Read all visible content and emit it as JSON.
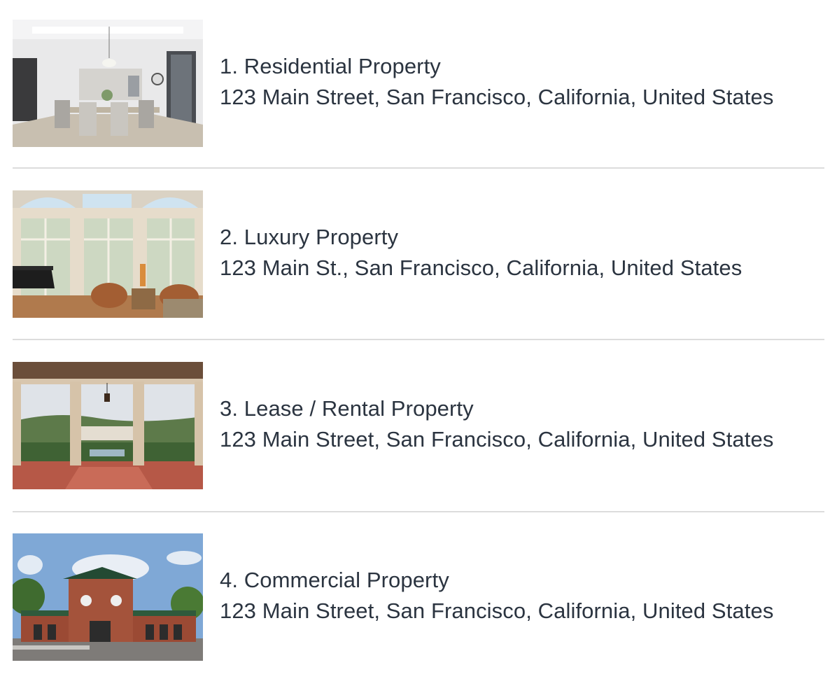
{
  "listings": [
    {
      "title": "1. Residential Property",
      "address": "123 Main Street, San Francisco, California, United States",
      "thumbnail": "dining-room-photo"
    },
    {
      "title": "2. Luxury Property",
      "address": "123 Main St., San Francisco, California, United States",
      "thumbnail": "living-room-photo"
    },
    {
      "title": "3. Lease / Rental Property",
      "address": "123 Main Street, San Francisco, California, United States",
      "thumbnail": "courtyard-photo"
    },
    {
      "title": "4. Commercial Property",
      "address": "123 Main Street, San Francisco, California, United States",
      "thumbnail": "commercial-building-photo"
    }
  ],
  "colors": {
    "text": "#2b3440",
    "divider": "#dcdcdc",
    "background": "#ffffff"
  }
}
